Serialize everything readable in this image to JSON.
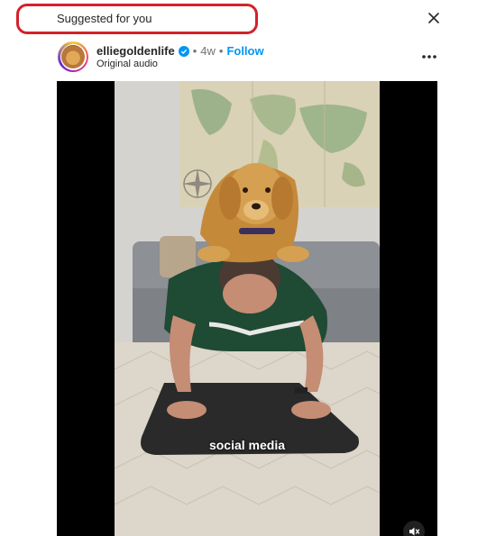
{
  "banner": {
    "label": "Suggested for you"
  },
  "post": {
    "username": "elliegoldenlife",
    "separator": "•",
    "time": "4w",
    "follow_label": "Follow",
    "audio": "Original audio"
  },
  "video": {
    "caption": "social media"
  },
  "icons": {
    "close": "close-icon",
    "verified": "verified-badge-icon",
    "more": "more-options-icon",
    "mute": "speaker-muted-icon"
  },
  "colors": {
    "highlight": "#d3222a",
    "follow": "#0095f6",
    "verified": "#0095f6"
  }
}
